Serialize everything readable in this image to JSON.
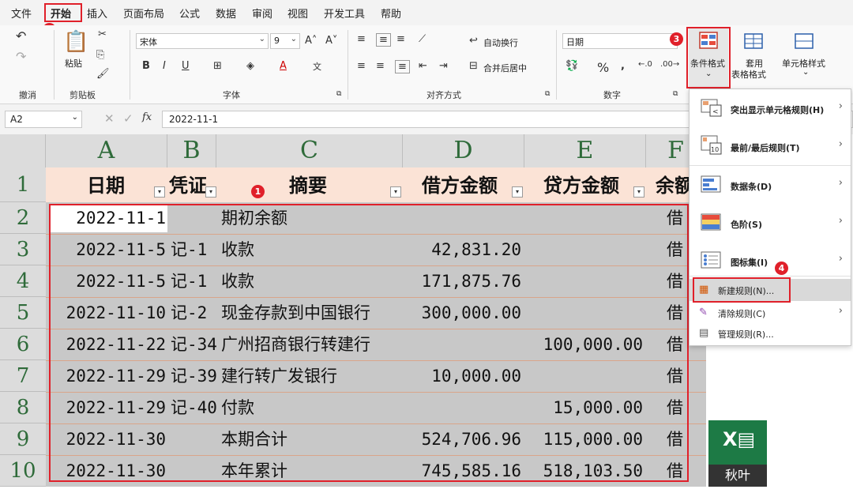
{
  "menubar": {
    "items": [
      "文件",
      "开始",
      "插入",
      "页面布局",
      "公式",
      "数据",
      "审阅",
      "视图",
      "开发工具",
      "帮助"
    ]
  },
  "ribbon": {
    "clipboard": {
      "paste": "粘贴",
      "label": "剪贴板",
      "undo_label": "撤消"
    },
    "font": {
      "name": "宋体",
      "size": "9",
      "label": "字体",
      "bold": "B",
      "italic": "I",
      "underline": "U"
    },
    "alignment": {
      "wrap": "自动换行",
      "merge": "合并后居中",
      "label": "对齐方式"
    },
    "number": {
      "format": "日期",
      "label": "数字",
      "percent": "%"
    },
    "styles": {
      "cond_format": "条件格式",
      "table_format_1": "套用",
      "table_format_2": "表格格式",
      "cell_style": "单元格样式"
    }
  },
  "formula": {
    "cell_ref": "A2",
    "fx": "fx",
    "value": "2022-11-1"
  },
  "sheet": {
    "columns": [
      "A",
      "B",
      "C",
      "D",
      "E",
      "F"
    ],
    "rows": [
      "1",
      "2",
      "3",
      "4",
      "5",
      "6",
      "7",
      "8",
      "9",
      "10"
    ],
    "headers": [
      "日期",
      "凭证",
      "摘要",
      "借方金额",
      "贷方金额",
      "余额"
    ],
    "data": [
      [
        "2022-11-1",
        "",
        "期初余额",
        "",
        "",
        "借"
      ],
      [
        "2022-11-5",
        "记-1",
        "收款",
        "42,831.20",
        "",
        "借"
      ],
      [
        "2022-11-5",
        "记-1",
        "收款",
        "171,875.76",
        "",
        "借"
      ],
      [
        "2022-11-10",
        "记-2",
        "现金存款到中国银行",
        "300,000.00",
        "",
        "借"
      ],
      [
        "2022-11-22",
        "记-34",
        "广州招商银行转建行",
        "",
        "100,000.00",
        "借"
      ],
      [
        "2022-11-29",
        "记-39",
        "建行转广发银行",
        "10,000.00",
        "",
        "借"
      ],
      [
        "2022-11-29",
        "记-40",
        "付款",
        "",
        "15,000.00",
        "借"
      ],
      [
        "2022-11-30",
        "",
        "本期合计",
        "524,706.96",
        "115,000.00",
        "借"
      ],
      [
        "2022-11-30",
        "",
        "本年累计",
        "745,585.16",
        "518,103.50",
        "借"
      ]
    ]
  },
  "dropdown": {
    "items": [
      {
        "label": "突出显示单元格规则(H)"
      },
      {
        "label": "最前/最后规则(T)"
      },
      {
        "label": "数据条(D)"
      },
      {
        "label": "色阶(S)"
      },
      {
        "label": "图标集(I)"
      }
    ],
    "sub_items": [
      {
        "label": "新建规则(N)..."
      },
      {
        "label": "清除规则(C)"
      },
      {
        "label": "管理规则(R)..."
      }
    ]
  },
  "badges": [
    "1",
    "2",
    "3",
    "4"
  ],
  "logo": {
    "text": "秋叶"
  },
  "colors": {
    "accent": "#e0202a",
    "header_fill": "#fbe3d6",
    "selection": "#c8c8c8",
    "excel_green": "#1d7a45"
  }
}
